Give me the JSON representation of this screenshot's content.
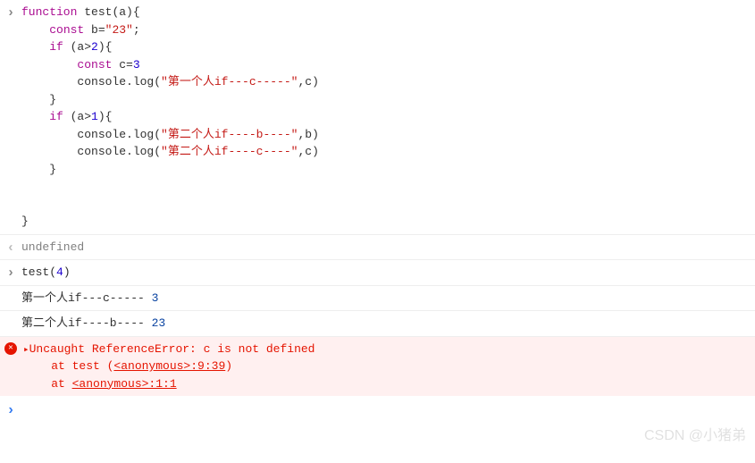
{
  "code": {
    "tokens": [
      [
        "kw",
        "function"
      ],
      [
        "fn",
        " test"
      ],
      [
        "",
        ", "
      ],
      [
        "",
        "(a){\n"
      ],
      [
        "",
        "    "
      ],
      [
        "kw",
        "const"
      ],
      [
        "",
        " b="
      ],
      [
        "str",
        "\"23\""
      ],
      [
        "",
        ";\n"
      ],
      [
        "",
        "    "
      ],
      [
        "kw",
        "if"
      ],
      [
        "",
        " (a>"
      ],
      [
        "num",
        "2"
      ],
      [
        "",
        "){\n"
      ],
      [
        "",
        "        "
      ],
      [
        "kw",
        "const"
      ],
      [
        "",
        " c="
      ],
      [
        "num",
        "3"
      ],
      [
        "",
        "\n"
      ],
      [
        "",
        "        console.log("
      ],
      [
        "str",
        "\"第一个人if---c-----\""
      ],
      [
        "",
        ",c)\n"
      ],
      [
        "",
        "    }\n"
      ],
      [
        "",
        "    "
      ],
      [
        "kw",
        "if"
      ],
      [
        "",
        " (a>"
      ],
      [
        "num",
        "1"
      ],
      [
        "",
        "){\n"
      ],
      [
        "",
        "        console.log("
      ],
      [
        "str",
        "\"第二个人if----b----\""
      ],
      [
        "",
        ",b)\n"
      ],
      [
        "",
        "        console.log("
      ],
      [
        "str",
        "\"第二个人if----c----\""
      ],
      [
        "",
        ",c)\n"
      ],
      [
        "",
        "    }\n"
      ],
      [
        "",
        "\n"
      ],
      [
        "",
        "\n"
      ],
      [
        "",
        "}"
      ]
    ],
    "l1_kw_function": "function",
    "l1_fn": " test",
    "l1_rest": "(a){",
    "l2_indent": "    ",
    "l2_kw": "const",
    "l2_mid": " b=",
    "l2_str": "\"23\"",
    "l2_end": ";",
    "l3_indent": "    ",
    "l3_kw": "if",
    "l3_mid": " (a>",
    "l3_num": "2",
    "l3_end": "){",
    "l4_indent": "        ",
    "l4_kw": "const",
    "l4_mid": " c=",
    "l4_num": "3",
    "l5_indent": "        ",
    "l5_pre": "console.log(",
    "l5_str": "\"第一个人if---c-----\"",
    "l5_end": ",c)",
    "l6": "    }",
    "l7_indent": "    ",
    "l7_kw": "if",
    "l7_mid": " (a>",
    "l7_num": "1",
    "l7_end": "){",
    "l8_indent": "        ",
    "l8_pre": "console.log(",
    "l8_str": "\"第二个人if----b----\"",
    "l8_end": ",b)",
    "l9_indent": "        ",
    "l9_pre": "console.log(",
    "l9_str": "\"第二个人if----c----\"",
    "l9_end": ",c)",
    "l10": "    }",
    "l11": "",
    "l12": "",
    "l13": "}"
  },
  "result1": "undefined",
  "input2": "test(",
  "input2_num": "4",
  "input2_end": ")",
  "out1_text": "第一个人if---c----- ",
  "out1_val": "3",
  "out2_text": "第二个人if----b---- ",
  "out2_val": "23",
  "error": {
    "msg": "Uncaught ReferenceError: c is not defined",
    "at1_pre": "    at test (",
    "at1_link": "<anonymous>:9:39",
    "at1_end": ")",
    "at2_pre": "    at ",
    "at2_link": "<anonymous>:1:1"
  },
  "watermark": "CSDN @小猪弟"
}
